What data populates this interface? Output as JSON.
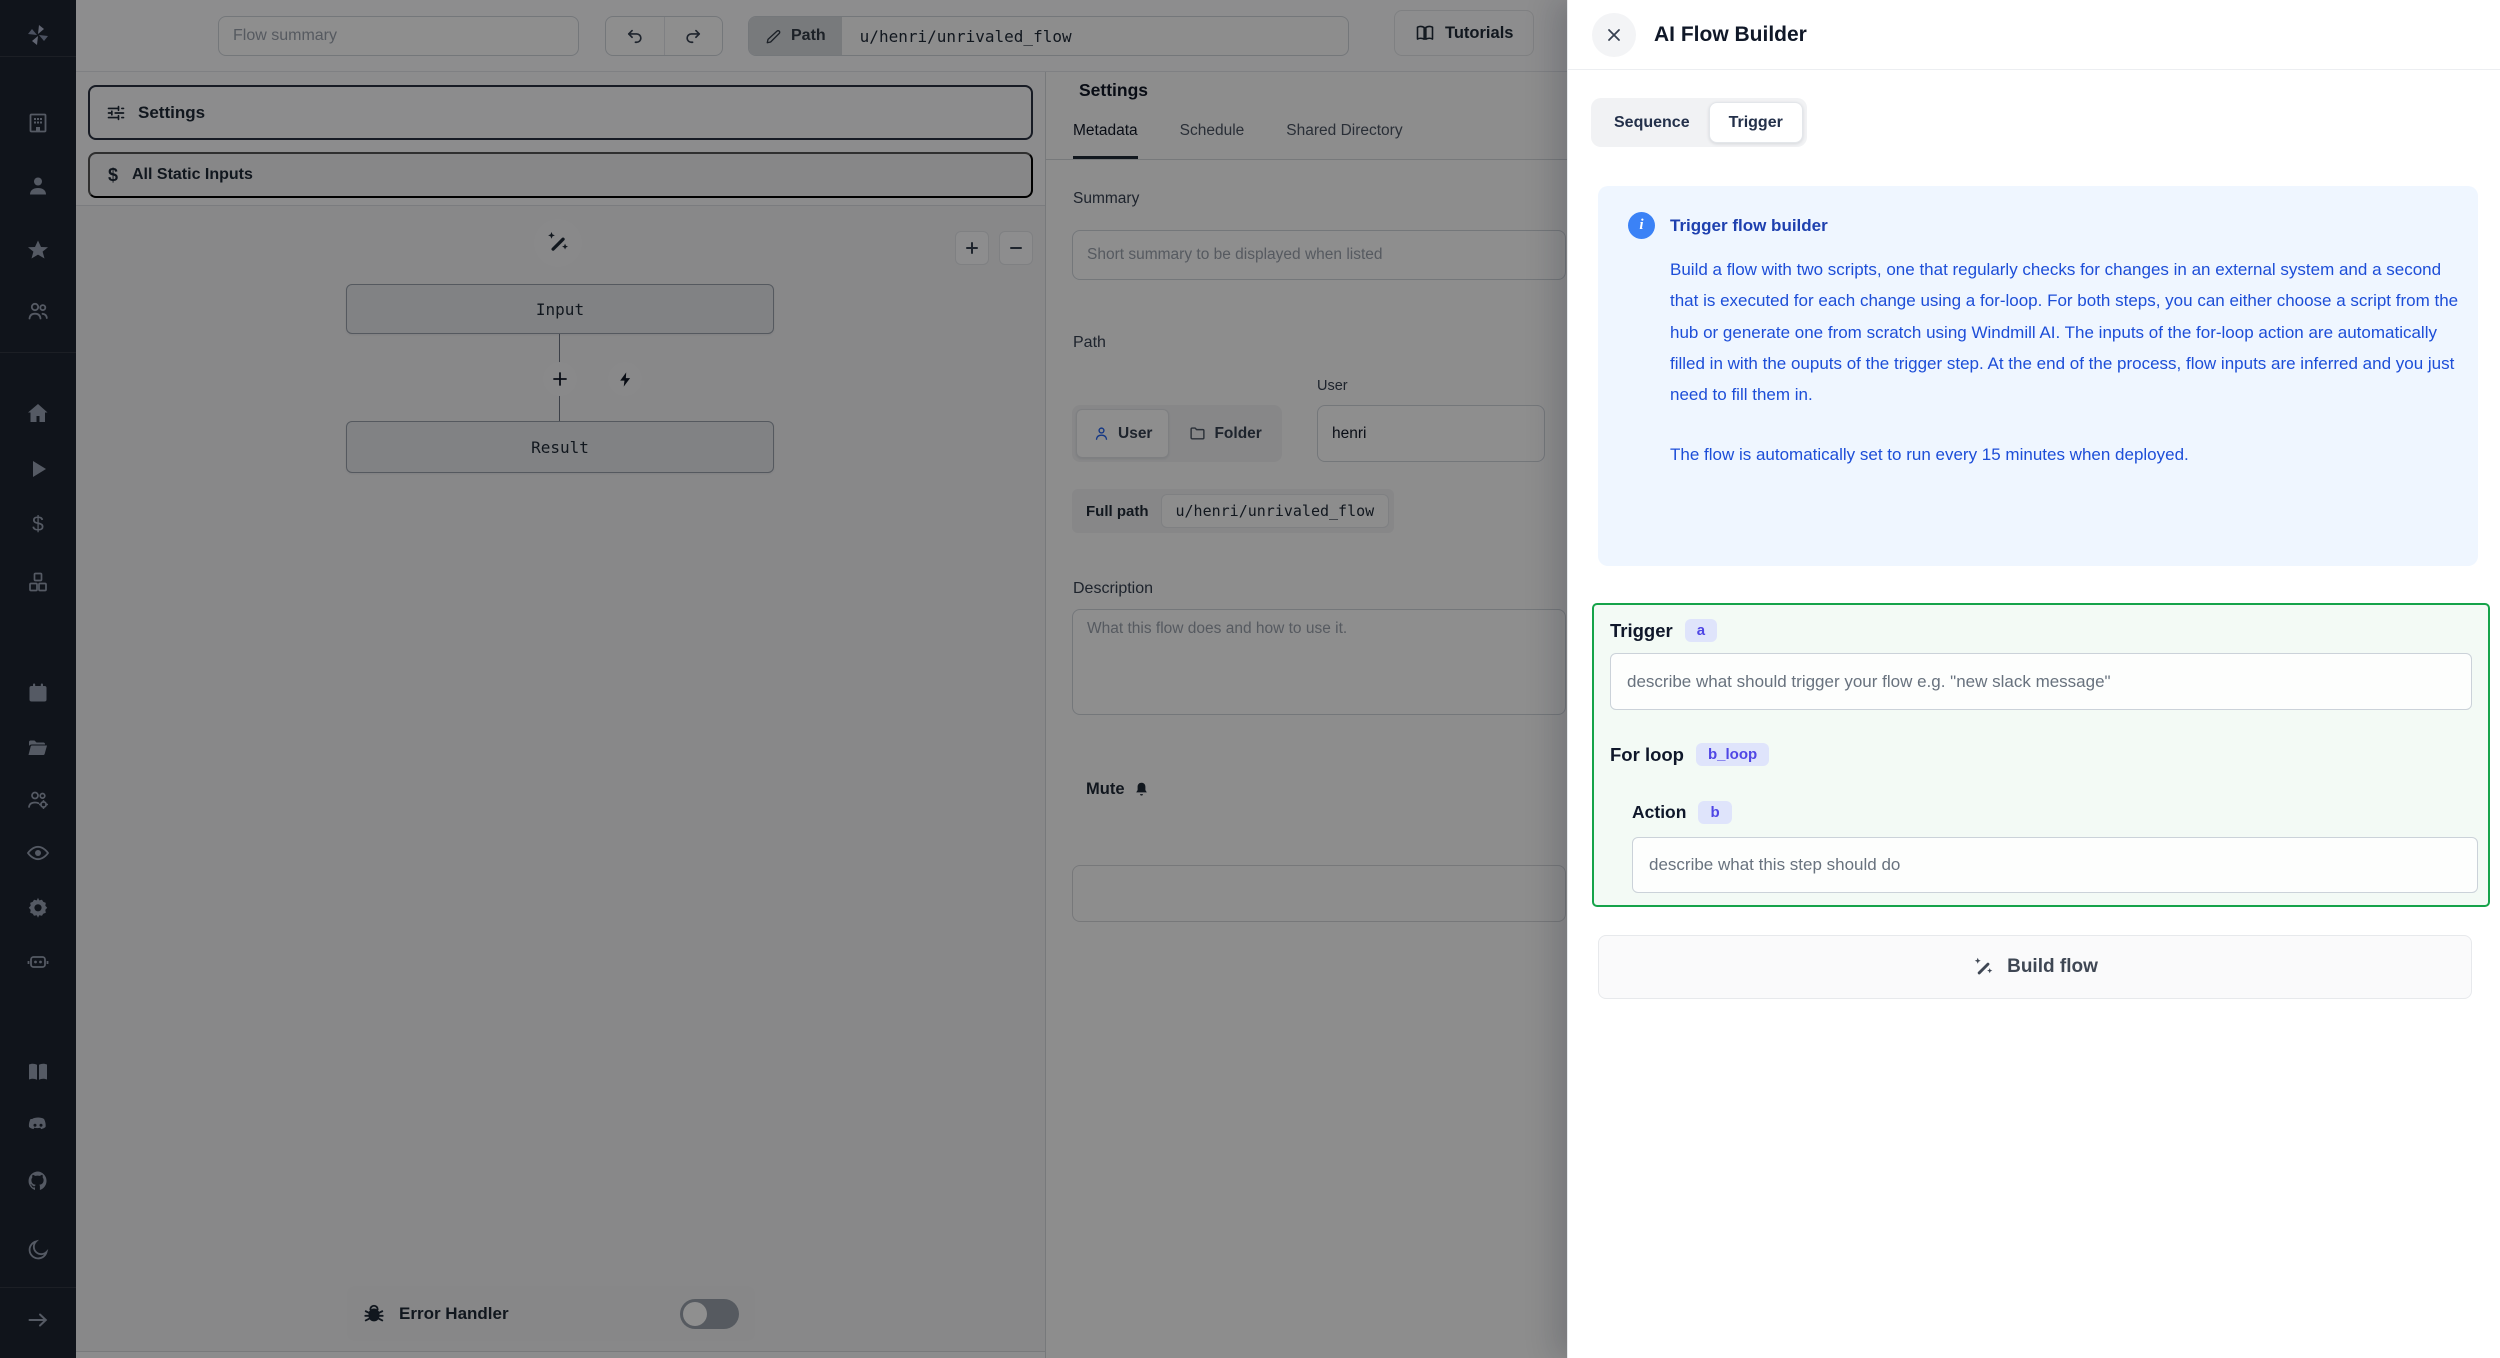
{
  "topbar": {
    "flow_summary_placeholder": "Flow summary",
    "path_label": "Path",
    "path_value": "u/henri/unrivaled_flow",
    "tutorials_label": "Tutorials"
  },
  "editor": {
    "settings_label": "Settings",
    "static_inputs_label": "All Static Inputs",
    "input_node_label": "Input",
    "result_node_label": "Result",
    "error_handler_label": "Error Handler"
  },
  "settings_panel": {
    "title": "Settings",
    "tabs": [
      "Metadata",
      "Schedule",
      "Shared Directory"
    ],
    "summary_label": "Summary",
    "summary_placeholder": "Short summary to be displayed when listed",
    "path_label": "Path",
    "user_field_label": "User",
    "user_toggle_label": "User",
    "folder_toggle_label": "Folder",
    "owner_value": "henri",
    "full_path_label": "Full path",
    "full_path_value": "u/henri/unrivaled_flow",
    "description_label": "Description",
    "description_placeholder": "What this flow does and how to use it.",
    "mute_label": "Mute"
  },
  "drawer": {
    "title": "AI Flow Builder",
    "tabs": [
      {
        "label": "Sequence",
        "active": false
      },
      {
        "label": "Trigger",
        "active": true
      }
    ],
    "info": {
      "title": "Trigger flow builder",
      "body": "Build a flow with two scripts, one that regularly checks for changes in an external system and a second that is executed for each change using a for-loop. For both steps, you can either choose a script from the hub or generate one from scratch using Windmill AI. The inputs of the for-loop action are automatically filled in with the ouputs of the trigger step. At the end of the process, flow inputs are inferred and you just need to fill them in.",
      "footer": "The flow is automatically set to run every 15 minutes when deployed."
    },
    "builder": {
      "trigger_label": "Trigger",
      "trigger_badge": "a",
      "trigger_placeholder": "describe what should trigger your flow e.g. \"new slack message\"",
      "forloop_label": "For loop",
      "forloop_badge": "b_loop",
      "action_label": "Action",
      "action_badge": "b",
      "action_placeholder": "describe what this step should do"
    },
    "build_button_label": "Build flow"
  },
  "icons": {
    "dollar": "$",
    "sidebar_order": [
      "windmill-logo",
      "workspace-building",
      "user",
      "favorites-star",
      "groups-users",
      "home",
      "runs-play",
      "variables-dollar",
      "resources-cubes",
      "schedules-calendar",
      "folders",
      "workers-users-gear",
      "audit-eye",
      "settings-gear",
      "ai-bot",
      "docs-book",
      "discord",
      "github",
      "dark-mode-moon",
      "expand-arrow"
    ]
  },
  "colors": {
    "sidebar_bg": "#1E2530",
    "accent_green": "#16A34A",
    "info_bg": "#EFF6FF",
    "info_icon": "#3B82F6",
    "info_title": "#1E40AF",
    "info_body": "#1D4ED8",
    "badge_bg": "#DFE4FB",
    "badge_text": "#4F46E5",
    "overlay": "rgba(0,0,0,0.44)"
  }
}
